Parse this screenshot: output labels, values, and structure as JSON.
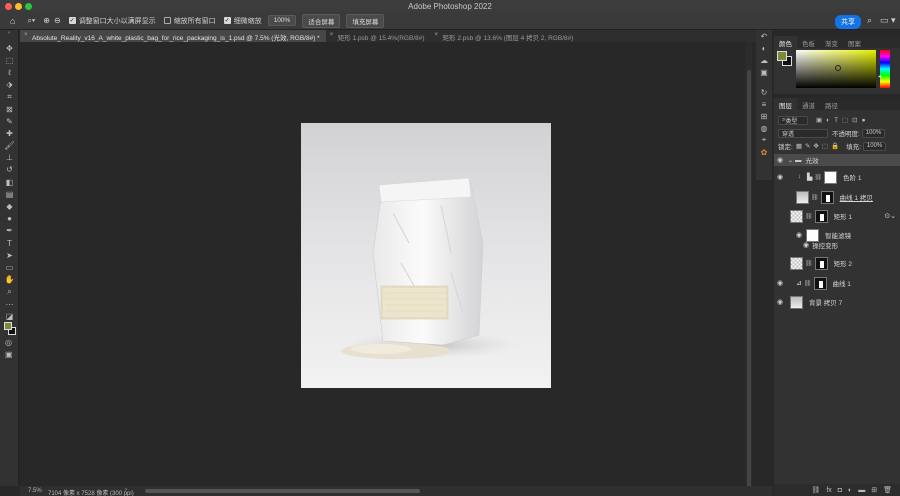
{
  "window": {
    "title": "Adobe Photoshop 2022"
  },
  "options_bar": {
    "resize_windows_label": "调整窗口大小以满屏显示",
    "zoom_all_windows_label": "缩放所有窗口",
    "scrubby_zoom_label": "细微缩放",
    "zoom_value": "100%",
    "fit_screen_label": "适合屏幕",
    "fill_screen_label": "填充屏幕",
    "share_label": "共享"
  },
  "tabs": [
    {
      "label": "Absolute_Reality_v16_A_white_plastic_bag_for_rice_packaging_is_1.psd @ 7.5% (光效, RGB/8#) *"
    },
    {
      "label": "矩形 1.psb @ 15.4%(RGB/8#)"
    },
    {
      "label": "矩形 2.psb @ 13.6% (图层 4 拷贝 2, RGB/8#)"
    }
  ],
  "status_bar": {
    "zoom": "7.5%",
    "doc_size": "7104 像素 x 7528 像素 (300 ppi)"
  },
  "color_panel": {
    "tabs": [
      "颜色",
      "色板",
      "渐变",
      "图案"
    ],
    "foreground": "#7d8a3a",
    "background": "#111111"
  },
  "layers_panel": {
    "tabs": [
      "图层",
      "通道",
      "路径"
    ],
    "kind_filter": "类型",
    "blend_mode": "穿透",
    "opacity_label": "不透明度:",
    "opacity_value": "100%",
    "lock_label": "锁定:",
    "fill_label": "填充:",
    "fill_value": "100%",
    "layers": [
      {
        "name": "光效",
        "kind": "group"
      },
      {
        "name": "色阶 1",
        "kind": "adjustment"
      },
      {
        "name": "曲线 1 拷贝",
        "kind": "adjustment"
      },
      {
        "name": "矩形 1",
        "kind": "smart-object"
      },
      {
        "name": "智能滤镜",
        "kind": "filter-mask"
      },
      {
        "name": "操控变形",
        "kind": "filter"
      },
      {
        "name": "矩形 2",
        "kind": "smart-object"
      },
      {
        "name": "曲线 1",
        "kind": "adjustment"
      },
      {
        "name": "背景 拷贝 7",
        "kind": "pixel"
      }
    ]
  },
  "icons": {
    "home": "⌂",
    "zoom": "🔍",
    "eye": "◉",
    "link": "⛓"
  }
}
